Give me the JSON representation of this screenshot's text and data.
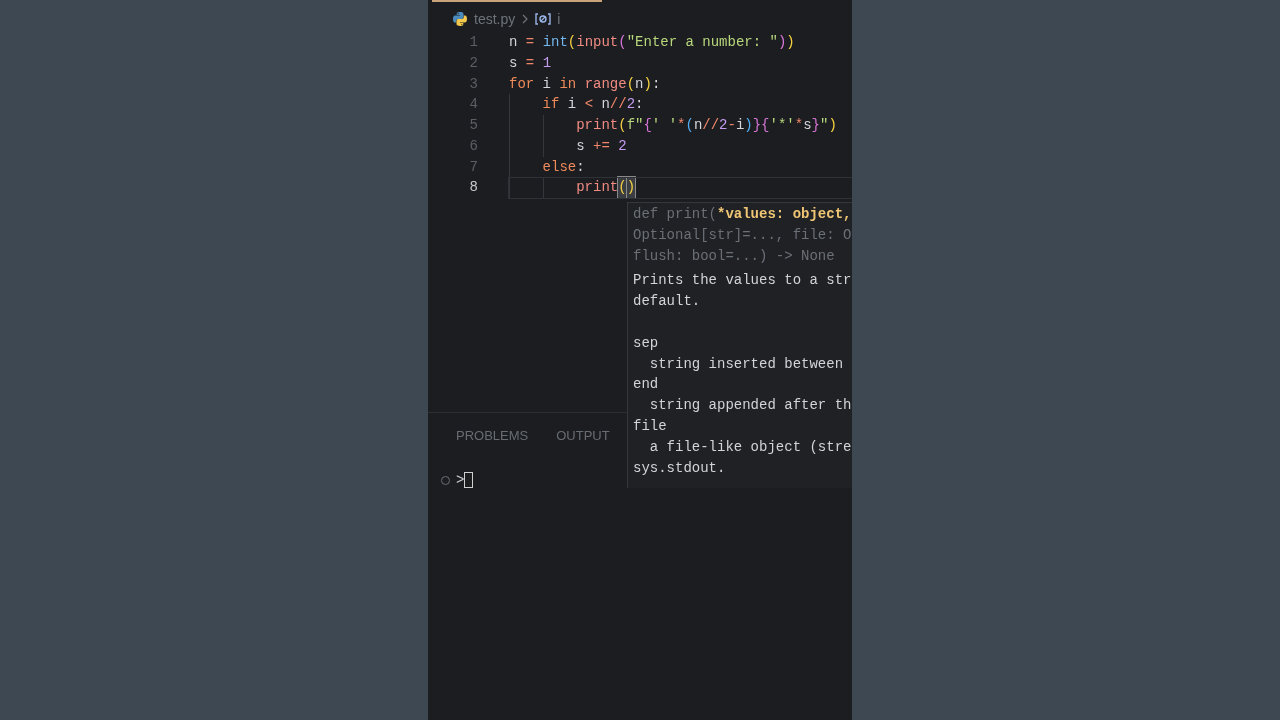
{
  "breadcrumb": {
    "file": "test.py",
    "symbol": "i"
  },
  "editor": {
    "lines": [
      {
        "number": "1",
        "current_line": false,
        "tokens": [
          {
            "kind": "var",
            "text": "n"
          },
          {
            "kind": "op",
            "text": " = "
          },
          {
            "kind": "type",
            "text": "int"
          },
          {
            "kind": "b1",
            "text": "("
          },
          {
            "kind": "func",
            "text": "input"
          },
          {
            "kind": "b2",
            "text": "("
          },
          {
            "kind": "str",
            "text": "\"Enter a number: \""
          },
          {
            "kind": "b2",
            "text": ")"
          },
          {
            "kind": "b1",
            "text": ")"
          }
        ]
      },
      {
        "number": "2",
        "current_line": false,
        "tokens": [
          {
            "kind": "var",
            "text": "s"
          },
          {
            "kind": "op",
            "text": " = "
          },
          {
            "kind": "num",
            "text": "1"
          }
        ]
      },
      {
        "number": "3",
        "current_line": false,
        "tokens": [
          {
            "kind": "kw",
            "text": "for"
          },
          {
            "kind": "var",
            "text": " i "
          },
          {
            "kind": "kw",
            "text": "in "
          },
          {
            "kind": "func",
            "text": "range"
          },
          {
            "kind": "b1",
            "text": "("
          },
          {
            "kind": "var",
            "text": "n"
          },
          {
            "kind": "b1",
            "text": ")"
          },
          {
            "kind": "var",
            "text": ":"
          }
        ]
      },
      {
        "number": "4",
        "current_line": false,
        "tokens": [
          {
            "kind": "kw",
            "text": "    if"
          },
          {
            "kind": "var",
            "text": " i "
          },
          {
            "kind": "op",
            "text": "<"
          },
          {
            "kind": "var",
            "text": " n"
          },
          {
            "kind": "op",
            "text": "//"
          },
          {
            "kind": "num",
            "text": "2"
          },
          {
            "kind": "var",
            "text": ":"
          }
        ]
      },
      {
        "number": "5",
        "current_line": false,
        "tokens": [
          {
            "kind": "func",
            "text": "        print"
          },
          {
            "kind": "b1",
            "text": "("
          },
          {
            "kind": "str",
            "text": "f\""
          },
          {
            "kind": "b2",
            "text": "{"
          },
          {
            "kind": "str",
            "text": "' '"
          },
          {
            "kind": "op",
            "text": "*"
          },
          {
            "kind": "b3",
            "text": "("
          },
          {
            "kind": "var",
            "text": "n"
          },
          {
            "kind": "op",
            "text": "//"
          },
          {
            "kind": "num",
            "text": "2"
          },
          {
            "kind": "op",
            "text": "-"
          },
          {
            "kind": "var",
            "text": "i"
          },
          {
            "kind": "b3",
            "text": ")"
          },
          {
            "kind": "b2",
            "text": "}{"
          },
          {
            "kind": "str",
            "text": "'*'"
          },
          {
            "kind": "op",
            "text": "*"
          },
          {
            "kind": "var",
            "text": "s"
          },
          {
            "kind": "b2",
            "text": "}"
          },
          {
            "kind": "str",
            "text": "\""
          },
          {
            "kind": "b1",
            "text": ")"
          }
        ]
      },
      {
        "number": "6",
        "current_line": false,
        "tokens": [
          {
            "kind": "var",
            "text": "        s "
          },
          {
            "kind": "op",
            "text": "+="
          },
          {
            "kind": "num",
            "text": " 2"
          }
        ]
      },
      {
        "number": "7",
        "current_line": false,
        "tokens": [
          {
            "kind": "kw",
            "text": "    else"
          },
          {
            "kind": "var",
            "text": ":"
          }
        ]
      },
      {
        "number": "8",
        "current_line": true,
        "tokens": [
          {
            "kind": "func",
            "text": "        print"
          },
          {
            "kind": "match",
            "text": "("
          },
          {
            "kind": "cursor"
          },
          {
            "kind": "match",
            "text": ")"
          }
        ]
      }
    ]
  },
  "hover": {
    "signature": [
      [
        {
          "kind": "dim",
          "text": "def print("
        },
        {
          "kind": "param",
          "text": "*values: object,"
        }
      ],
      [
        {
          "kind": "dim",
          "text": "Optional[str]=..., file: O"
        }
      ],
      [
        {
          "kind": "dim",
          "text": "flush: bool=...) -> None"
        }
      ]
    ],
    "summary": [
      "Prints the values to a str",
      "default."
    ],
    "params": [
      "sep",
      "  string inserted between",
      "end",
      "  string appended after th",
      "file",
      "  a file-like object (stre",
      "sys.stdout."
    ]
  },
  "panel": {
    "tabs": [
      {
        "label": "PROBLEMS",
        "selected": false
      },
      {
        "label": "OUTPUT",
        "selected": false
      }
    ],
    "prompt": ">"
  }
}
